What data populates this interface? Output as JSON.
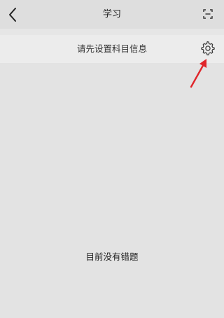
{
  "header": {
    "title": "学习",
    "back_icon": "chevron-left-icon",
    "scan_icon": "scan-icon"
  },
  "setting_bar": {
    "message": "请先设置科目信息",
    "settings_icon": "gear-icon"
  },
  "annotation": {
    "icon": "arrow-icon",
    "color": "#e0252a"
  },
  "main": {
    "empty_message": "目前没有错题"
  }
}
